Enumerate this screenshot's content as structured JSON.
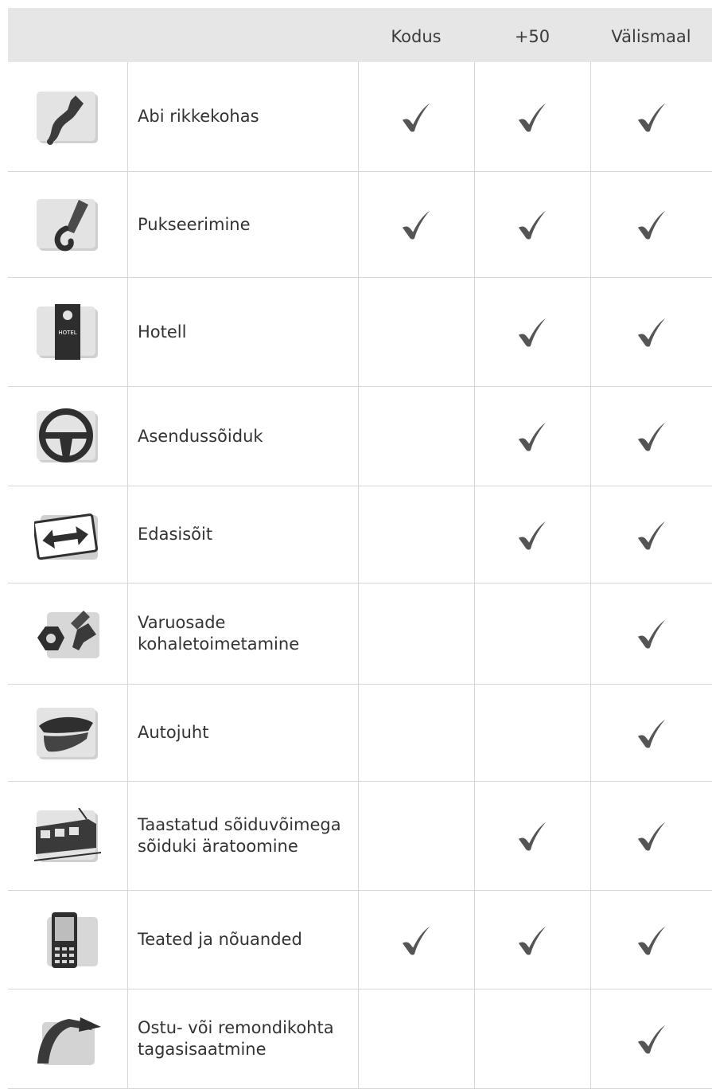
{
  "columns": [
    "Kodus",
    "+50",
    "Välismaal"
  ],
  "rows": [
    {
      "icon": "wrench-icon",
      "label": "Abi rikkekohas",
      "checks": [
        true,
        true,
        true
      ]
    },
    {
      "icon": "tow-hook-icon",
      "label": "Pukseerimine",
      "checks": [
        true,
        true,
        true
      ]
    },
    {
      "icon": "hotel-door-hanger-icon",
      "label": "Hotell",
      "checks": [
        false,
        true,
        true
      ]
    },
    {
      "icon": "steering-wheel-icon",
      "label": "Asendussõiduk",
      "checks": [
        false,
        true,
        true
      ]
    },
    {
      "icon": "double-arrow-sign-icon",
      "label": "Edasisõit",
      "checks": [
        false,
        true,
        true
      ]
    },
    {
      "icon": "nut-and-bolt-icon",
      "label": "Varuosade kohaletoimetamine",
      "checks": [
        false,
        false,
        true
      ]
    },
    {
      "icon": "chauffeur-cap-icon",
      "label": "Autojuht",
      "checks": [
        false,
        false,
        true
      ]
    },
    {
      "icon": "train-icon",
      "label": "Taastatud sõiduvõimega sõiduki äratoomine",
      "checks": [
        false,
        true,
        true
      ]
    },
    {
      "icon": "mobile-phone-icon",
      "label": "Teated ja nõuanded",
      "checks": [
        true,
        true,
        true
      ]
    },
    {
      "icon": "return-arrow-icon",
      "label": "Ostu- või remondikohta tagasisaatmine",
      "checks": [
        false,
        false,
        true
      ]
    }
  ],
  "colors": {
    "header_bg": "#e6e6e6",
    "check": "#555555",
    "grid": "#d6d6d6"
  }
}
